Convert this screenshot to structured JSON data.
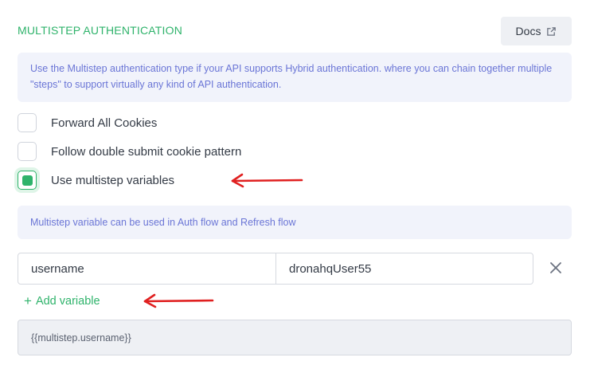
{
  "header": {
    "title": "MULTISTEP AUTHENTICATION",
    "docs_label": "Docs",
    "docs_icon": "external-link-icon"
  },
  "intro_info": "Use the Multistep authentication type if your API supports Hybrid authentication. where you can chain together multiple \"steps\" to support virtually any kind of API authentication.",
  "options": [
    {
      "label": "Forward All Cookies",
      "checked": false
    },
    {
      "label": "Follow double submit cookie pattern",
      "checked": false
    },
    {
      "label": "Use multistep variables",
      "checked": true
    }
  ],
  "variables_info": "Multistep variable can be used in Auth flow and Refresh flow",
  "variables": [
    {
      "key": "username",
      "value": "dronahqUser55"
    }
  ],
  "add_variable_label": "Add variable",
  "preview": "{{multistep.username}}",
  "colors": {
    "accent": "#2fb36b",
    "info_text": "#6a75d6",
    "annotation_arrow": "#e02020"
  }
}
